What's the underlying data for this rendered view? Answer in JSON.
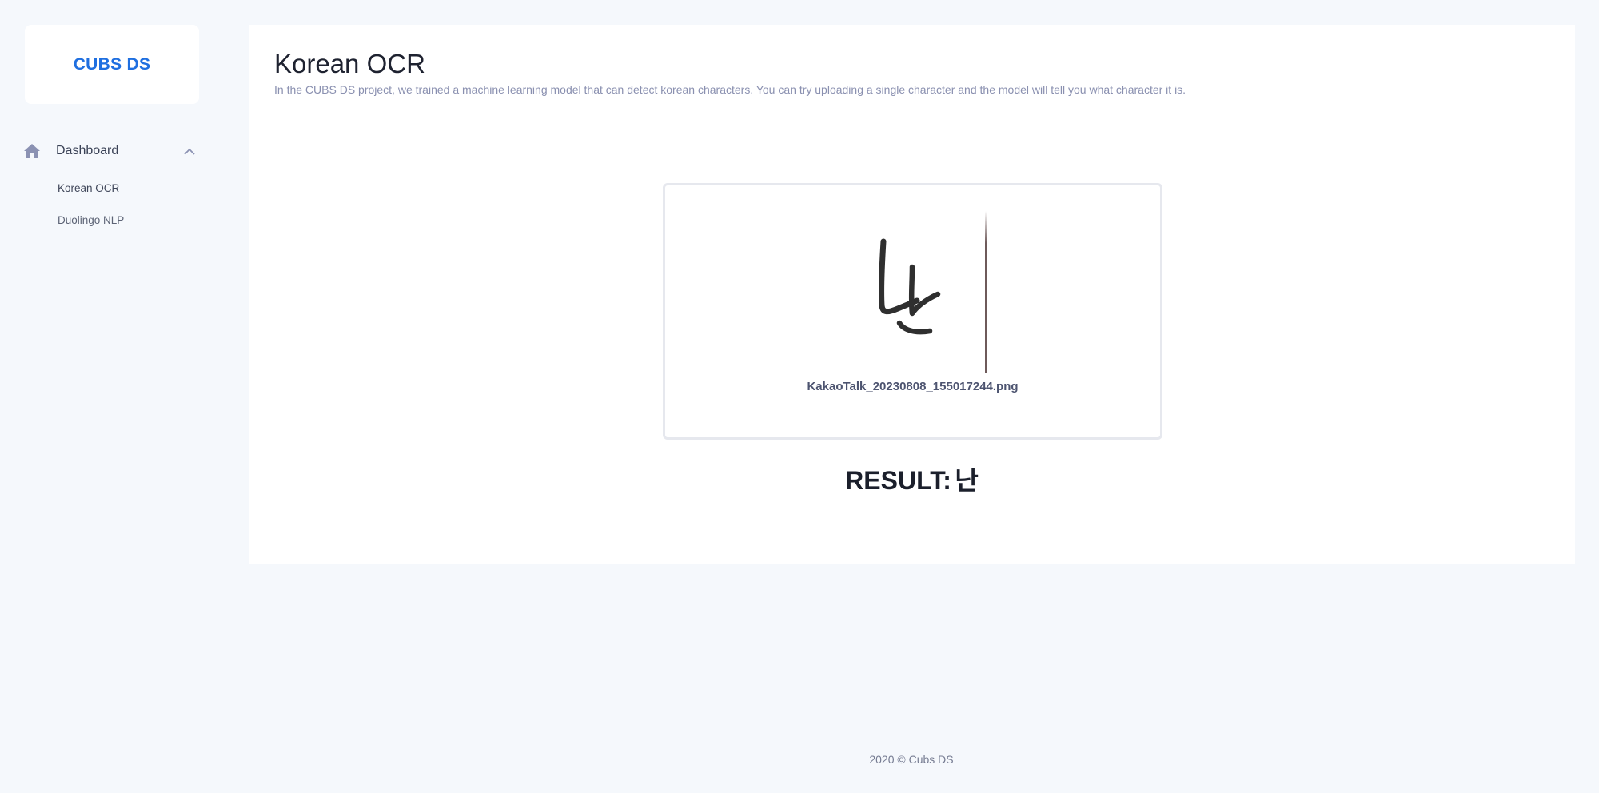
{
  "sidebar": {
    "brand": "CUBS DS",
    "nav_group": {
      "label": "Dashboard",
      "icon": "home-icon",
      "expanded": true
    },
    "items": [
      {
        "label": "Korean OCR"
      },
      {
        "label": "Duolingo NLP"
      }
    ]
  },
  "main": {
    "title": "Korean OCR",
    "description": "In the CUBS DS project, we trained a machine learning model that can detect korean characters. You can try uploading a single character and the model will tell you what character it is.",
    "upload": {
      "file_name": "KakaoTalk_20230808_155017244.png"
    },
    "result_label": "RESULT:",
    "result_value": "난"
  },
  "footer": {
    "text": "2020 © Cubs DS"
  },
  "colors": {
    "background": "#f5f8fc",
    "brand": "#1f6fe0",
    "card": "#ffffff",
    "description": "#8a90b0"
  }
}
